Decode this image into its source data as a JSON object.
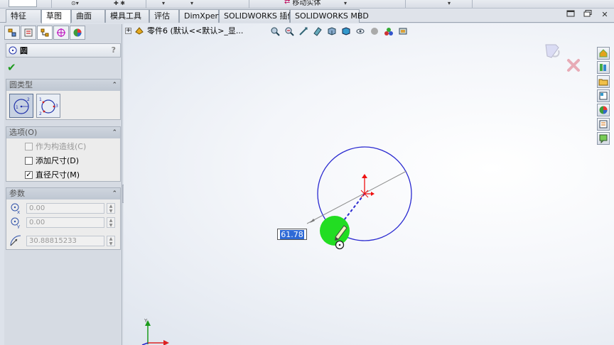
{
  "toolbar": {
    "move_entity_label": "移动实体"
  },
  "tabs": [
    {
      "label": "特征"
    },
    {
      "label": "草图"
    },
    {
      "label": "曲面"
    },
    {
      "label": "模具工具"
    },
    {
      "label": "评估"
    },
    {
      "label": "DimXpert"
    },
    {
      "label": "SOLIDWORKS 插件"
    },
    {
      "label": "SOLIDWORKS MBD"
    }
  ],
  "property_manager": {
    "title": "圆",
    "help": "?",
    "circle_type": {
      "header": "圆类型"
    },
    "options": {
      "header": "选项(O)",
      "construction_label": "作为构造线(C)",
      "add_dimension_label": "添加尺寸(D)",
      "diameter_dimension_label": "直径尺寸(M)",
      "construction_checked": false,
      "add_dimension_checked": false,
      "diameter_dimension_checked": true
    },
    "parameters": {
      "header": "参数",
      "center_x": "0.00",
      "center_y": "0.00",
      "radius": "30.88815233"
    }
  },
  "feature_tree": {
    "part_label": "零件6  (默认<<默认>_显..."
  },
  "dimension": {
    "value": "61.78"
  },
  "triad": {
    "y_label": "Y"
  },
  "colors": {
    "circle": "#2a2ad0",
    "accent_green": "#22dd22",
    "selection_blue": "#2e6ad6",
    "origin_red": "#e11"
  }
}
